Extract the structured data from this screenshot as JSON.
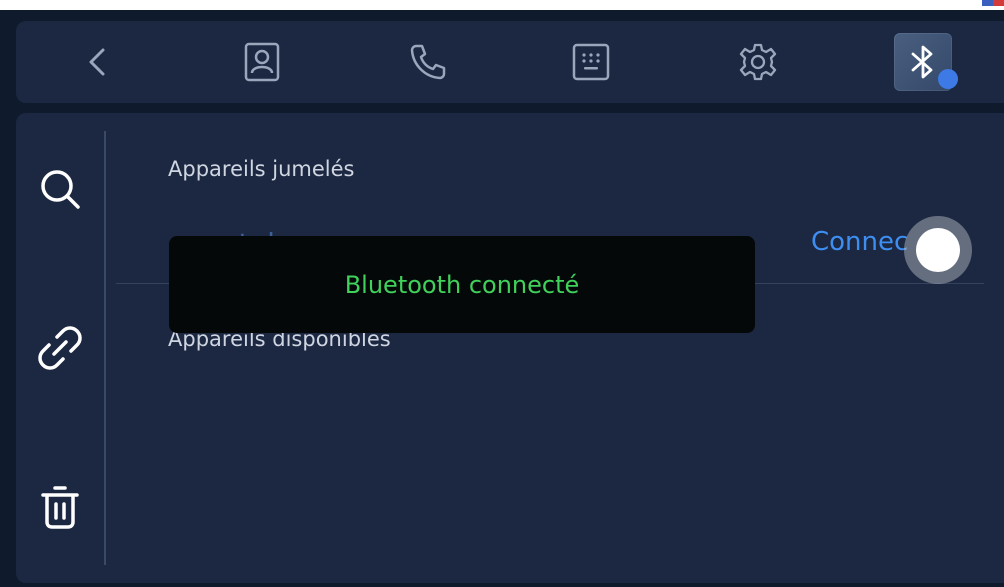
{
  "toolbar": {
    "buttons": [
      {
        "id": "back",
        "icon": "chevron-left-icon"
      },
      {
        "id": "contacts",
        "icon": "contact-icon"
      },
      {
        "id": "calls",
        "icon": "phone-icon"
      },
      {
        "id": "dialpad",
        "icon": "dialpad-icon"
      },
      {
        "id": "settings",
        "icon": "gear-icon"
      },
      {
        "id": "bluetooth",
        "icon": "bluetooth-icon",
        "active": true
      }
    ]
  },
  "sidebar": {
    "tools": [
      {
        "id": "search",
        "icon": "search-icon"
      },
      {
        "id": "unpair",
        "icon": "unlink-icon"
      },
      {
        "id": "delete",
        "icon": "trash-icon"
      }
    ]
  },
  "main": {
    "paired_title": "Appareils jumelés",
    "paired_devices": [
      {
        "name": "smartphone",
        "status": "Connec"
      }
    ],
    "available_title": "Appareils disponibles"
  },
  "toast": {
    "message": "Bluetooth connecté"
  },
  "colors": {
    "background": "#0f1a2c",
    "panel": "#1c2841",
    "accent": "#3d8ef0",
    "toast_text": "#3fd15a"
  }
}
